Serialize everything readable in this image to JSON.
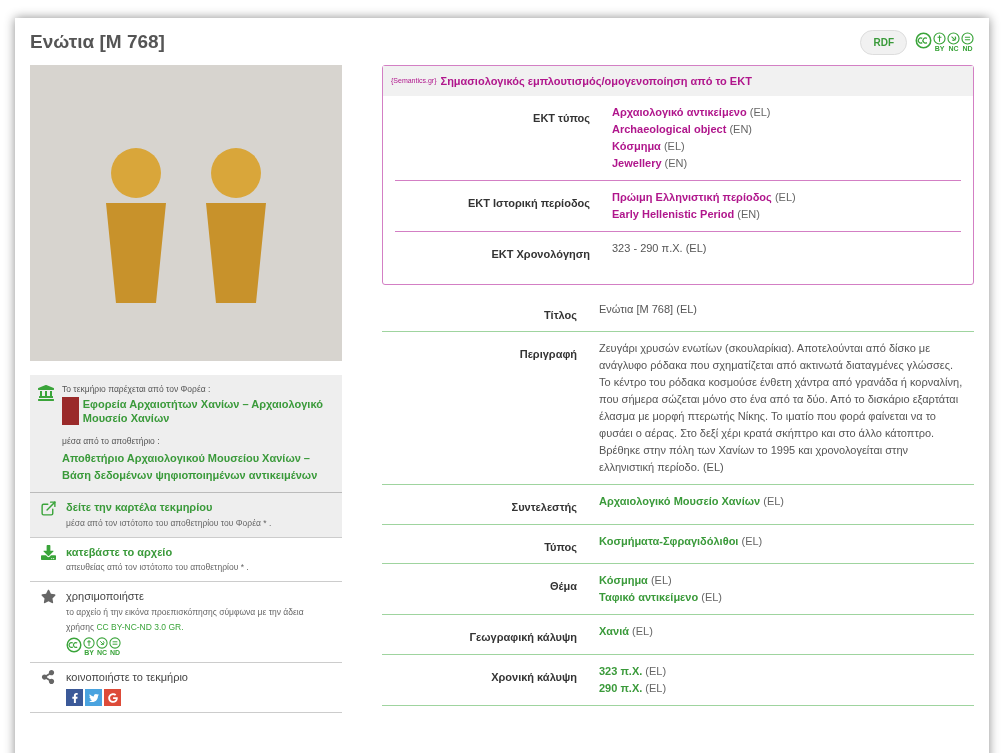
{
  "title": "Ενώτια [M 768]",
  "header": {
    "rdf_button": "RDF",
    "license_marks": [
      "BY",
      "NC",
      "ND"
    ]
  },
  "provider": {
    "intro": "Το τεκμήριο παρέχεται από τον Φορέα :",
    "name": "Εφορεία Αρχαιοτήτων Χανίων – Αρχαιολογικό Μουσείο Χανίων",
    "via": "μέσα από το αποθετήριο :",
    "repository": "Αποθετήριο Αρχαιολογικού Μουσείου Χανίων – Βάση δεδομένων ψηφιοποιημένων αντικειμένων"
  },
  "actions": [
    {
      "kind": "view",
      "title": "δείτε την καρτέλα τεκμηρίου",
      "note": "μέσα από τον ιστότοπο του αποθετηρίου του Φορέα * ."
    },
    {
      "kind": "download",
      "title": "κατεβάστε το αρχείο",
      "note": "απευθείας από τον ιστότοπο του αποθετηρίου * ."
    },
    {
      "kind": "use",
      "title": "χρησιμοποιήστε",
      "note": "το αρχείο ή την εικόνα προεπισκόπησης σύμφωνα με την άδεια χρήσης",
      "license_link": "CC BY-NC-ND 3.0 GR.",
      "license_marks": [
        "BY",
        "NC",
        "ND"
      ]
    },
    {
      "kind": "share",
      "title": "κοινοποιήστε το τεκμήριο"
    }
  ],
  "semantics": {
    "logo": "{Semantics.gr}",
    "heading": "Σημασιολογικός εμπλουτισμός/ομογενοποίηση από το ΕΚΤ",
    "rows": [
      {
        "label": "ΕΚΤ τύπος",
        "values": [
          {
            "kind": "link",
            "text": "Αρχαιολογικό αντικείμενο",
            "lang": "(EL)"
          },
          {
            "kind": "link",
            "text": "Archaeological object",
            "lang": "(EN)"
          },
          {
            "kind": "link",
            "text": "Κόσμημα",
            "lang": "(EL)"
          },
          {
            "kind": "link",
            "text": "Jewellery",
            "lang": "(EN)"
          }
        ]
      },
      {
        "label": "ΕΚΤ Ιστορική περίοδος",
        "values": [
          {
            "kind": "link",
            "text": "Πρώιμη Ελληνιστική περίοδος",
            "lang": "(EL)"
          },
          {
            "kind": "link",
            "text": "Early Hellenistic Period",
            "lang": "(EN)"
          }
        ]
      },
      {
        "label": "ΕΚΤ Χρονολόγηση",
        "values": [
          {
            "kind": "plain",
            "text": "323 - 290 π.Χ.",
            "lang": "(EL)"
          }
        ]
      }
    ]
  },
  "fields": [
    {
      "label": "Τίτλος",
      "values": [
        {
          "kind": "plain",
          "text": "Ενώτια [M 768]",
          "lang": "(EL)"
        }
      ]
    },
    {
      "label": "Περιγραφή",
      "values": [
        {
          "kind": "plain",
          "text": "Ζευγάρι χρυσών ενωτίων (σκουλαρίκια). Αποτελούνται από δίσκο με ανάγλυφο ρόδακα που σχηματίζεται από ακτινωτά διαταγμένες γλώσσες. Το κέντρο του ρόδακα κοσμούσε ένθετη χάντρα από γρανάδα ή κορναλίνη, που σήμερα σώζεται μόνο στο ένα από τα δύο. Από το δισκάριο εξαρτάται έλασμα με μορφή πτερωτής Νίκης. Το ιματίο που φορά φαίνεται να το φυσάει ο αέρας. Στο δεξί χέρι κρατά σκήπτρο και στο άλλο κάτοπτρο. Βρέθηκε στην πόλη των Χανίων το 1995 και χρονολογείται στην ελληνιστική περίοδο.",
          "lang": "(EL)"
        }
      ]
    },
    {
      "label": "Συντελεστής",
      "values": [
        {
          "kind": "link",
          "text": "Αρχαιολογικό Μουσείο Χανίων",
          "lang": "(EL)"
        }
      ]
    },
    {
      "label": "Τύπος",
      "values": [
        {
          "kind": "link",
          "text": "Κοσμήματα-Σφραγιδόλιθοι",
          "lang": "(EL)"
        }
      ]
    },
    {
      "label": "Θέμα",
      "values": [
        {
          "kind": "link",
          "text": "Κόσμημα",
          "lang": "(EL)"
        },
        {
          "kind": "link",
          "text": "Ταφικό αντικείμενο",
          "lang": "(EL)"
        }
      ]
    },
    {
      "label": "Γεωγραφική κάλυψη",
      "values": [
        {
          "kind": "link",
          "text": "Χανιά",
          "lang": "(EL)"
        }
      ]
    },
    {
      "label": "Χρονική κάλυψη",
      "values": [
        {
          "kind": "link",
          "text": "323 π.Χ.",
          "lang": "(EL)"
        },
        {
          "kind": "link",
          "text": "290 π.Χ.",
          "lang": "(EL)"
        }
      ]
    }
  ]
}
